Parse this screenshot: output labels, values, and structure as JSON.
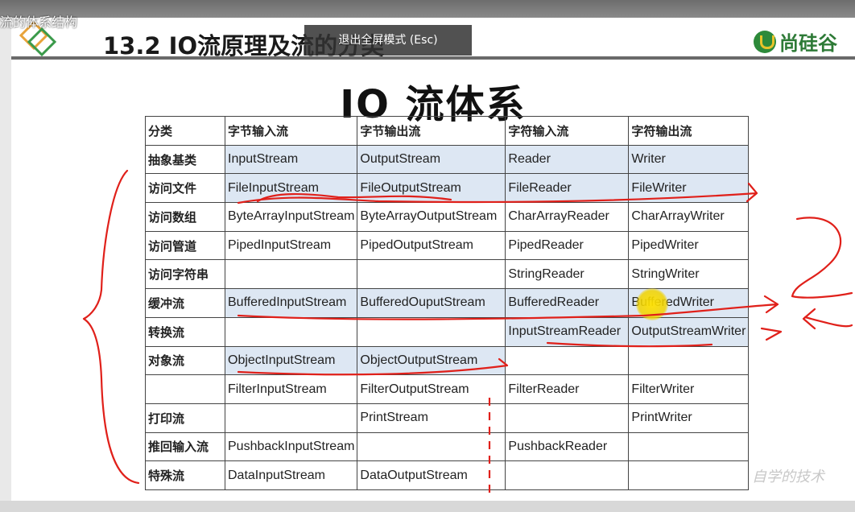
{
  "window": {
    "title_fragment": "流的体系结构"
  },
  "header": {
    "section_title": "13.2 IO流原理及流的分类",
    "exit_fullscreen": "退出全屏模式 (Esc)",
    "brand": "尚硅谷"
  },
  "slide": {
    "title": "IO 流体系"
  },
  "table": {
    "headers": [
      "分类",
      "字节输入流",
      "字节输出流",
      "字符输入流",
      "字符输出流"
    ],
    "rows": [
      [
        "抽象基类",
        "InputStream",
        "OutputStream",
        "Reader",
        "Writer"
      ],
      [
        "访问文件",
        "FileInputStream",
        "FileOutputStream",
        "FileReader",
        "FileWriter"
      ],
      [
        "访问数组",
        "ByteArrayInputStream",
        "ByteArrayOutputStream",
        "CharArrayReader",
        "CharArrayWriter"
      ],
      [
        "访问管道",
        "PipedInputStream",
        "PipedOutputStream",
        "PipedReader",
        "PipedWriter"
      ],
      [
        "访问字符串",
        "",
        "",
        "StringReader",
        "StringWriter"
      ],
      [
        "缓冲流",
        "BufferedInputStream",
        "BufferedOuputStream",
        "BufferedReader",
        "BufferedWriter"
      ],
      [
        "转换流",
        "",
        "",
        "InputStreamReader",
        "OutputStreamWriter"
      ],
      [
        "对象流",
        "ObjectInputStream",
        "ObjectOutputStream",
        "",
        ""
      ],
      [
        "",
        "FilterInputStream",
        "FilterOutputStream",
        "FilterReader",
        "FilterWriter"
      ],
      [
        "打印流",
        "",
        "PrintStream",
        "",
        "PrintWriter"
      ],
      [
        "推回输入流",
        "PushbackInputStream",
        "",
        "PushbackReader",
        ""
      ],
      [
        "特殊流",
        "DataInputStream",
        "DataOutputStream",
        "",
        ""
      ]
    ]
  },
  "watermark": "自学的技术",
  "colors": {
    "highlight": "#dde7f3",
    "annotation": "#e0201a",
    "brand": "#2d7a36",
    "cursor": "#f2d600"
  }
}
